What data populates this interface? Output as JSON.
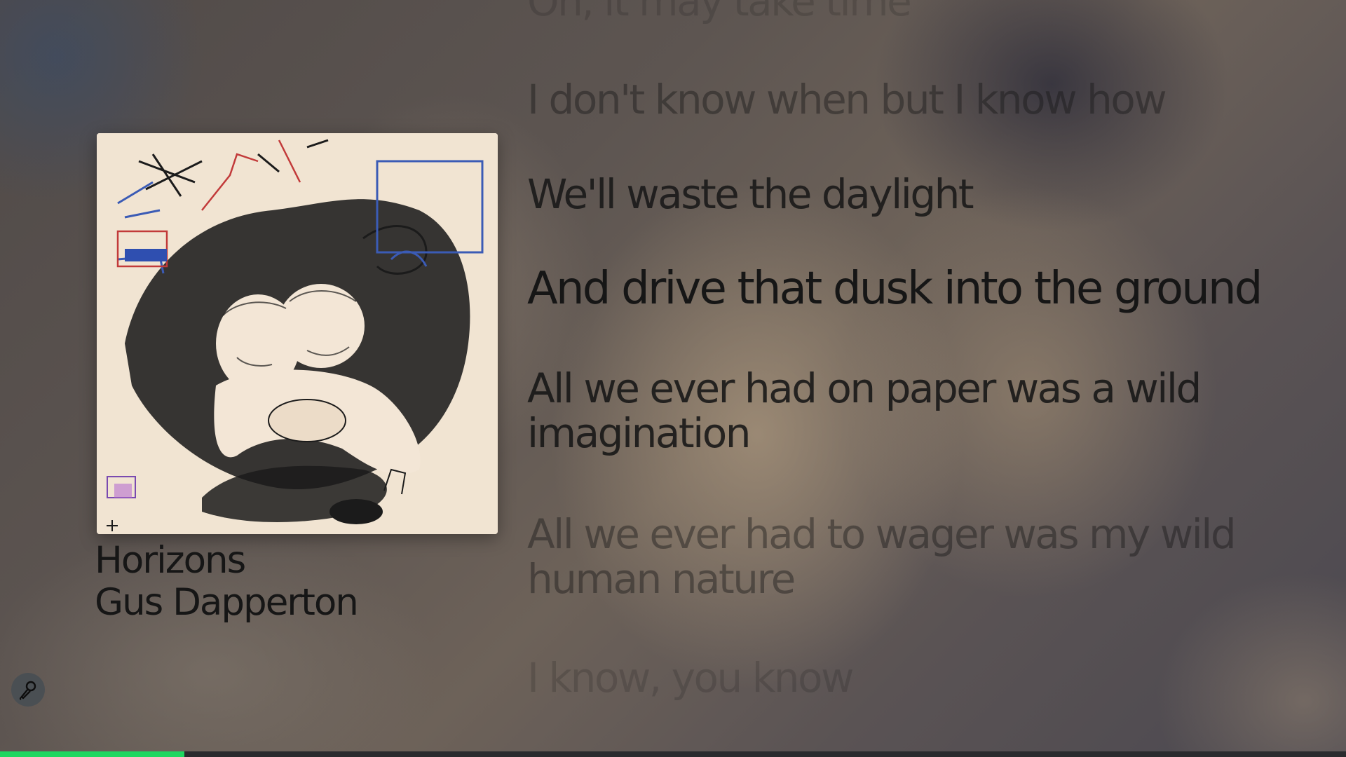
{
  "track": {
    "title": "Horizons",
    "artist": "Gus Dapperton",
    "cover_icon": "album-cover-art"
  },
  "lyrics": {
    "lines": [
      "Oh, it may take time",
      "I don't know when but I know how",
      "We'll waste the daylight",
      "And drive that dusk into the ground",
      "All we ever had on paper was a wild\nimagination",
      "All we ever had to wager was my wild\nhuman nature",
      "I know, you know"
    ],
    "active_index": 3
  },
  "controls": {
    "mic_icon": "microphone-icon"
  },
  "progress": {
    "fraction": 0.137,
    "accent": "#1ed760"
  }
}
